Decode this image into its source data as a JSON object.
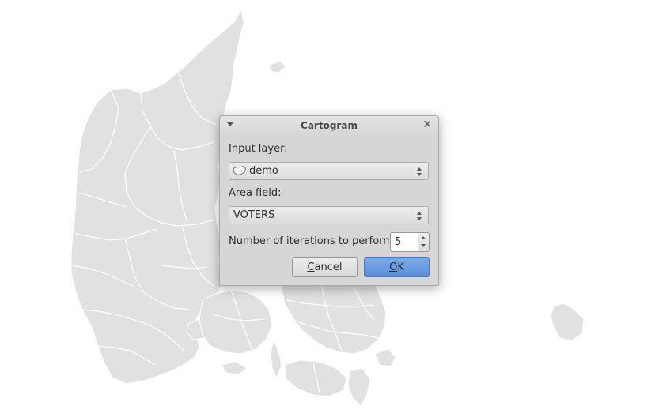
{
  "dialog": {
    "title": "Cartogram",
    "input_layer_label": "Input layer:",
    "input_layer_value": "demo",
    "input_layer_icon": "polygon-layer-icon",
    "area_field_label": "Area field:",
    "area_field_value": "VOTERS",
    "iterations_label": "Number of iterations to perform:",
    "iterations_value": "5",
    "cancel_label": "Cancel",
    "ok_label": "OK"
  },
  "colors": {
    "map_fill": "#e1e1e1",
    "map_borders": "#ffffff",
    "dialog_bg": "#d6d6d6",
    "ok_button": "#5b8fd6"
  }
}
